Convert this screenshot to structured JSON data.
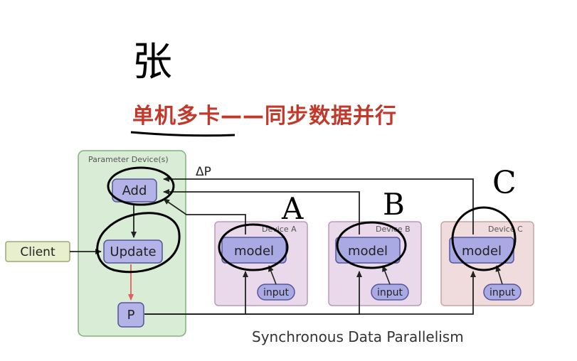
{
  "title": "单机多卡——同步数据并行",
  "handwritten_note": "张",
  "footer": "Synchronous Data Parallelism",
  "param_group_label": "Parameter Device(s)",
  "delta_label": "ΔP",
  "nodes": {
    "client": "Client",
    "add": "Add",
    "update": "Update",
    "p": "P"
  },
  "devices": [
    {
      "label": "Device A",
      "model": "model",
      "input": "input",
      "annotation": "A"
    },
    {
      "label": "Device B",
      "model": "model",
      "input": "input",
      "annotation": "B"
    },
    {
      "label": "Device C",
      "model": "model",
      "input": "input",
      "annotation": "C"
    }
  ],
  "colors": {
    "title_red": "#c0392b",
    "param_fill": "#d8ecd6",
    "param_border": "#7fb27a",
    "node_fill": "#b3b3e8",
    "node_border": "#555599",
    "client_fill": "#e8efcf",
    "device_a_fill": "#ead9ea",
    "device_b_fill": "#ead9ea",
    "device_c_fill": "#f0dcdc",
    "arrow_red": "#e06060"
  }
}
